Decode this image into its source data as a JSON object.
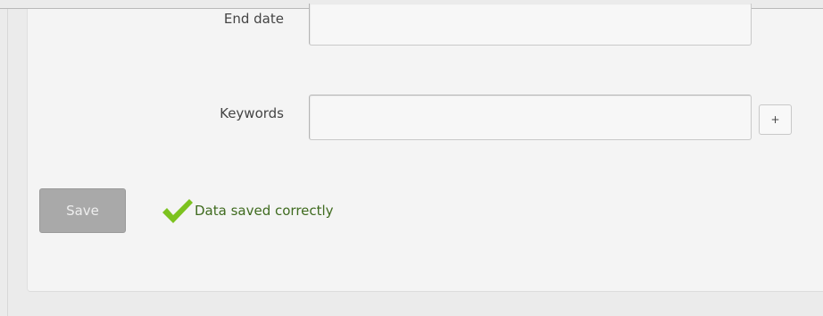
{
  "form": {
    "end_date": {
      "label": "End date",
      "value": "",
      "placeholder": ""
    },
    "keywords": {
      "label": "Keywords",
      "value": "",
      "placeholder": "",
      "add_label": "+"
    }
  },
  "actions": {
    "save_label": "Save"
  },
  "status": {
    "icon": "checkmark-icon",
    "message": "Data saved correctly",
    "color": "#3f6b1f",
    "icon_color": "#7cc21f"
  },
  "colors": {
    "save_button_bg": "#a9a9a9",
    "panel_bg": "#f4f4f4",
    "page_bg": "#ebebeb"
  }
}
